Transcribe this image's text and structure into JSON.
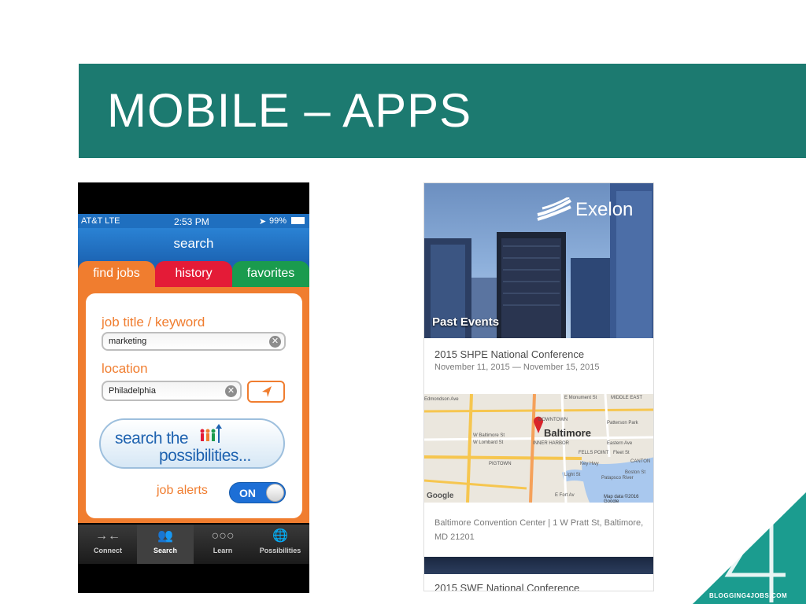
{
  "slide": {
    "title": "MOBILE – APPS"
  },
  "phone_left": {
    "status": {
      "carrier": "AT&T  LTE",
      "time": "2:53 PM",
      "battery": "99%"
    },
    "nav_title": "search",
    "tabs": [
      {
        "label": "find jobs",
        "color": "#f07d2f"
      },
      {
        "label": "history",
        "color": "#e41b37"
      },
      {
        "label": "favorites",
        "color": "#1a9b4e"
      }
    ],
    "form": {
      "keyword_label": "job title / keyword",
      "keyword_value": "marketing",
      "location_label": "location",
      "location_value": "Philadelphia",
      "search_button_line1": "search the",
      "search_button_line2": "possibilities...",
      "alerts_label": "job alerts",
      "alerts_toggle": "ON"
    },
    "tabbar": [
      {
        "label": "Connect",
        "icon": "connect-arrows-icon"
      },
      {
        "label": "Search",
        "icon": "people-icon",
        "active": true
      },
      {
        "label": "Learn",
        "icon": "dots-icon"
      },
      {
        "label": "Possibilities",
        "icon": "globe-icon"
      }
    ]
  },
  "phone_right": {
    "brand": "Exelon",
    "section": "Past Events",
    "events": [
      {
        "title": "2015 SHPE National Conference",
        "dates": "November 11, 2015 — November 15, 2015"
      },
      {
        "title": "2015 SWE National Conference"
      }
    ],
    "map": {
      "city": "Baltimore",
      "labels": [
        "Edmondson Ave",
        "E Monument St",
        "MIDDLE EAST",
        "W Baltimore St",
        "W Lombard St",
        "DOWNTOWN",
        "Patterson Park",
        "Eastern Ave",
        "FELLS POINT",
        "Fleet St",
        "CANTON",
        "PIGTOWN",
        "INNER HARBOR",
        "Boston St",
        "E Fort Av",
        "Light St",
        "Key Hwy",
        "Patapsco River"
      ],
      "attribution": "Google",
      "copyright": "Map data ©2016 Google"
    },
    "address": "Baltimore Convention Center | 1 W Pratt St, Baltimore, MD 21201"
  },
  "brand_corner": "BLOGGING4JOBS.COM",
  "colors": {
    "header": "#1c7a70",
    "orange": "#f07d2f",
    "blue": "#1f6fbf"
  }
}
